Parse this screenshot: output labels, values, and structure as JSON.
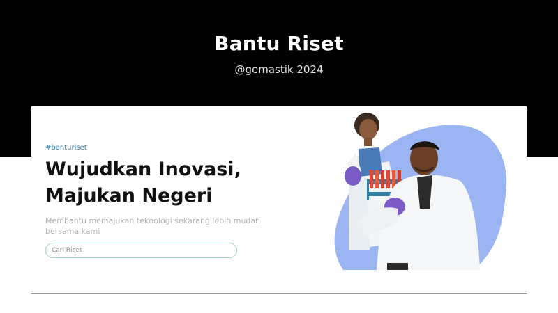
{
  "header": {
    "title": "Bantu Riset",
    "subtitle": "@gemastik 2024"
  },
  "hero": {
    "tag": "#banturiset",
    "headline_line1": "Wujudkan Inovasi,",
    "headline_line2": "Majukan Negeri",
    "description": "Membantu memajukan teknologi sekarang lebih mudah bersama kami",
    "search_placeholder": "Cari Riset",
    "image_icon": "scientists-illustration",
    "colors": {
      "blob": "#9bb5f2",
      "tag": "#2f7fb5",
      "search_border": "#9fcfc6"
    }
  }
}
